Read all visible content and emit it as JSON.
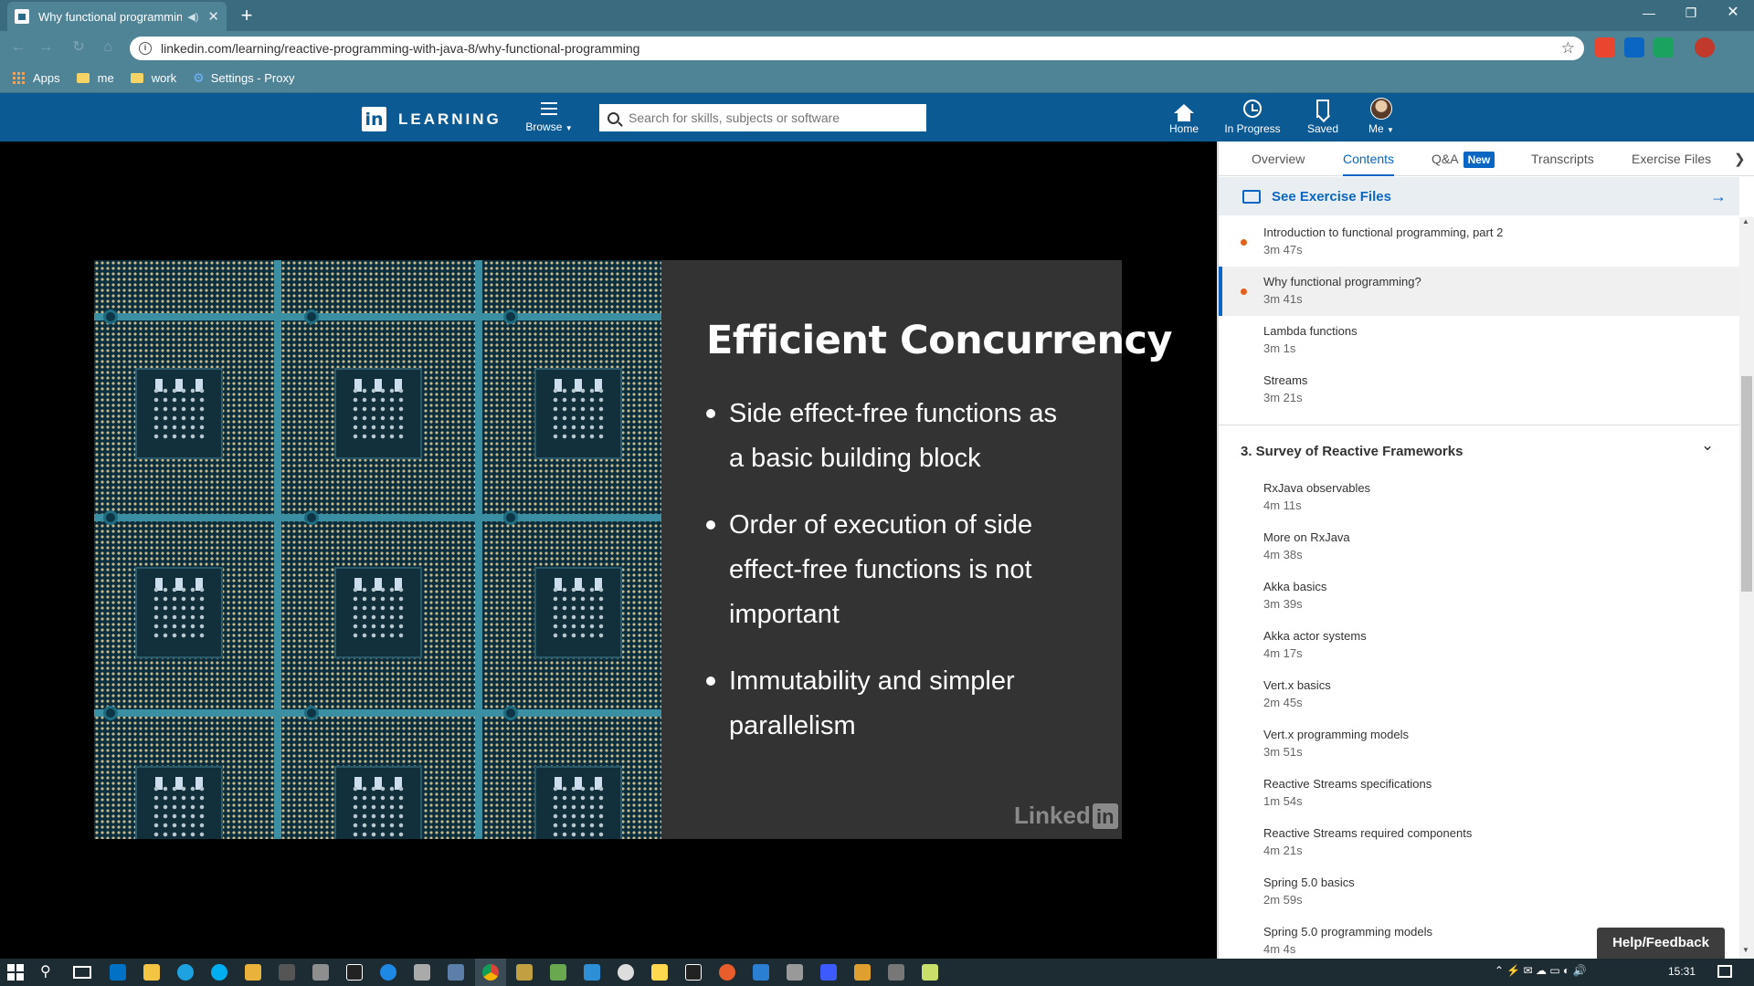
{
  "browser": {
    "tab_title": "Why functional programming?",
    "url": "linkedin.com/learning/reactive-programming-with-java-8/why-functional-programming",
    "bookmarks": [
      "Apps",
      "me",
      "work",
      "Settings - Proxy"
    ]
  },
  "header": {
    "logo_text": "LEARNING",
    "browse_label": "Browse",
    "search_placeholder": "Search for skills, subjects or software",
    "nav": [
      {
        "label": "Home",
        "icon": "home-icon"
      },
      {
        "label": "In Progress",
        "icon": "clock-icon"
      },
      {
        "label": "Saved",
        "icon": "bookmark-icon"
      },
      {
        "label": "Me",
        "icon": "avatar"
      }
    ]
  },
  "slide": {
    "title": "Efficient Concurrency",
    "bullets": [
      [
        "Side effect-free functions as",
        "a basic building block"
      ],
      [
        "Order of execution of side",
        "effect-free functions is not",
        "important"
      ],
      [
        "Immutability and simpler",
        "parallelism"
      ]
    ],
    "watermark": "Linked",
    "watermark_in": "in"
  },
  "panel": {
    "tabs": [
      "Overview",
      "Contents",
      "Q&A",
      "Transcripts",
      "Exercise Files"
    ],
    "active_tab": "Contents",
    "new_badge": "New",
    "exercise_link": "See Exercise Files",
    "items_top": [
      {
        "name": "Introduction to functional programming, part 2",
        "duration": "3m 47s",
        "watched": true
      },
      {
        "name": "Why functional programming?",
        "duration": "3m 41s",
        "watched": true,
        "current": true
      },
      {
        "name": "Lambda functions",
        "duration": "3m 1s"
      },
      {
        "name": "Streams",
        "duration": "3m 21s"
      }
    ],
    "section3_title": "3. Survey of Reactive Frameworks",
    "items_sec3": [
      {
        "name": "RxJava observables",
        "duration": "4m 11s"
      },
      {
        "name": "More on RxJava",
        "duration": "4m 38s"
      },
      {
        "name": "Akka basics",
        "duration": "3m 39s"
      },
      {
        "name": "Akka actor systems",
        "duration": "4m 17s"
      },
      {
        "name": "Vert.x basics",
        "duration": "2m 45s"
      },
      {
        "name": "Vert.x programming models",
        "duration": "3m 51s"
      },
      {
        "name": "Reactive Streams specifications",
        "duration": "1m 54s"
      },
      {
        "name": "Reactive Streams required components",
        "duration": "4m 21s"
      },
      {
        "name": "Spring 5.0 basics",
        "duration": "2m 59s"
      },
      {
        "name": "Spring 5.0 programming models",
        "duration": "4m 4s"
      }
    ],
    "help": "Help/Feedback"
  },
  "taskbar": {
    "clock": "15:31"
  },
  "colors": {
    "brand": "#0c5a94",
    "accent": "#0a66c2",
    "watched_dot": "#e3611d"
  }
}
